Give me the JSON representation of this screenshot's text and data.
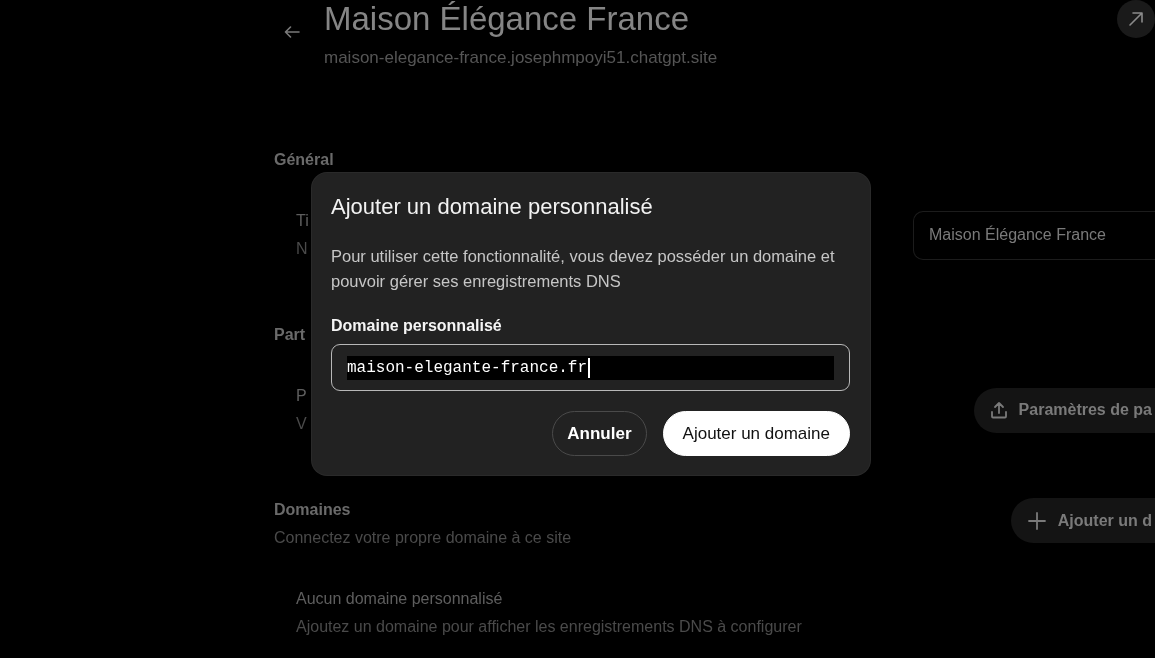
{
  "page": {
    "title": "Maison Élégance France",
    "url": "maison-elegance-france.josephmpoyi51.chatgpt.site",
    "sections": [
      {
        "heading": "Général",
        "rows": [
          {
            "label": "Ti",
            "description": "N",
            "control": {
              "kind": "field",
              "value": "Maison Élégance France"
            }
          }
        ]
      },
      {
        "heading": "Part",
        "rows": [
          {
            "label": "P",
            "description": "V",
            "control": {
              "kind": "upload",
              "label": "Paramètres de pa"
            }
          }
        ]
      },
      {
        "heading": "Domaines",
        "description": "Connectez votre propre domaine à ce site",
        "action": {
          "kind": "add",
          "label": "Ajouter un d"
        },
        "rows": [
          {
            "label": "Aucun domaine personnalisé",
            "description": "Ajoutez un domaine pour afficher les enregistrements DNS à configurer"
          }
        ]
      }
    ]
  },
  "dialog": {
    "title": "Ajouter un domaine personnalisé",
    "description": "Pour utiliser cette fonctionnalité, vous devez posséder un domaine et pouvoir gérer ses enregistrements DNS",
    "field_label": "Domaine personnalisé",
    "field_value": "maison-elegante-france.fr",
    "buttons": [
      {
        "label": "Annuler",
        "kind": "secondary"
      },
      {
        "label": "Ajouter un domaine",
        "kind": "primary"
      }
    ]
  }
}
